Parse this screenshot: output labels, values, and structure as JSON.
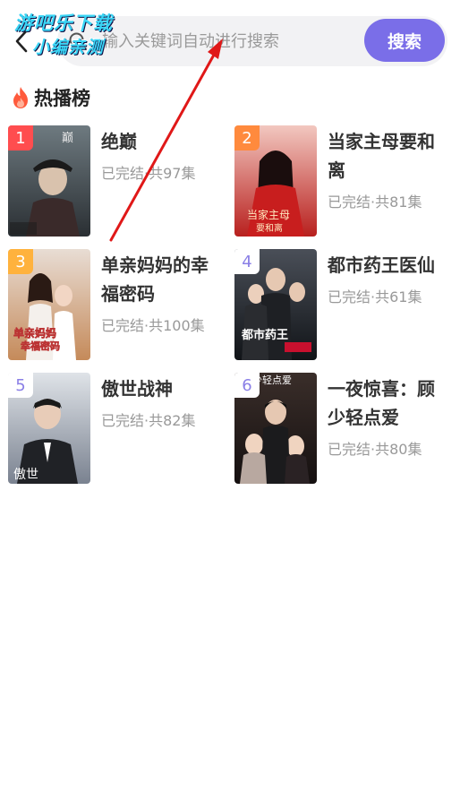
{
  "search": {
    "placeholder": "输入关键词自动进行搜索",
    "button_label": "搜索"
  },
  "watermark": {
    "line1": "游吧乐下载",
    "line2": "小编亲测"
  },
  "section": {
    "title": "热播榜"
  },
  "items": [
    {
      "rank": "1",
      "title": "绝巅",
      "meta": "已完结·共97集",
      "rank_color": "#ff4d4f",
      "poster_text": "绝巅"
    },
    {
      "rank": "2",
      "title": "当家主母要和离",
      "meta": "已完结·共81集",
      "rank_color": "#ff8a3d",
      "poster_text": "当家主母要和离"
    },
    {
      "rank": "3",
      "title": "单亲妈妈的幸福密码",
      "meta": "已完结·共100集",
      "rank_color": "#ffb23d",
      "poster_text": "单亲妈妈的幸福密码"
    },
    {
      "rank": "4",
      "title": "都市药王医仙",
      "meta": "已完结·共61集",
      "rank_color": "#ffffff",
      "poster_text": "都市药王"
    },
    {
      "rank": "5",
      "title": "傲世战神",
      "meta": "已完结·共82集",
      "rank_color": "#ffffff",
      "poster_text": "傲世战神"
    },
    {
      "rank": "6",
      "title": "一夜惊喜：顾少轻点爱",
      "meta": "已完结·共80集",
      "rank_color": "#ffffff",
      "poster_text": "顾少轻点爱"
    }
  ],
  "colors": {
    "accent": "#7a6ee8",
    "rank_plain_text": "#8a7fe6"
  }
}
